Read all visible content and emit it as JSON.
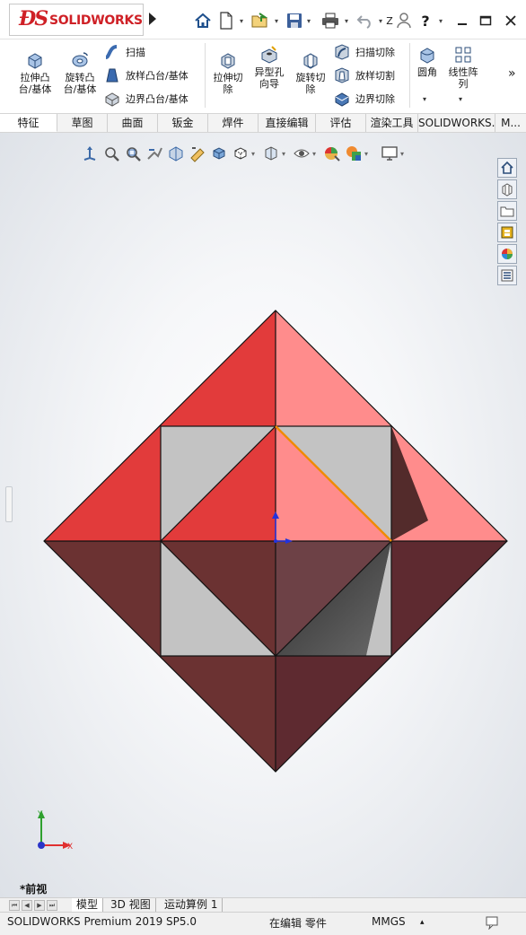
{
  "title_bar": {
    "brand": "SOLIDWORKS",
    "help_label": "?"
  },
  "ribbon": {
    "extrude_boss": "拉伸凸台/基体",
    "revolve_boss": "旋转凸台/基体",
    "sweep_boss": "扫描",
    "loft_boss": "放样凸台/基体",
    "boundary_boss": "边界凸台/基体",
    "extrude_cut": "拉伸切除",
    "hole_wizard": "异型孔向导",
    "revolve_cut": "旋转切除",
    "sweep_cut": "扫描切除",
    "loft_cut": "放样切割",
    "boundary_cut": "边界切除",
    "fillet": "圆角",
    "linear_pattern": "线性阵列",
    "overflow": "»"
  },
  "tabs": [
    "特征",
    "草图",
    "曲面",
    "钣金",
    "焊件",
    "直接编辑",
    "评估",
    "渲染工具",
    "SOLIDWORKS...",
    "M..."
  ],
  "viewport": {
    "view_name": "*前视",
    "triad_x": "X",
    "triad_y": "Y"
  },
  "bottom_tabs": [
    "模型",
    "3D 视图",
    "运动算例 1"
  ],
  "status": {
    "product": "SOLIDWORKS Premium 2019 SP5.0",
    "mode": "在编辑 零件",
    "units": "MMGS",
    "units_caret": "▴"
  },
  "colors": {
    "face_red": "#e23b3b",
    "face_pink": "#ff8c8c",
    "face_dark_left": "#6b3232",
    "face_dark_right": "#5e2a30",
    "square_gray": "#c3c3c3",
    "edge_selected": "#f08a00",
    "brand_red": "#cf2026"
  },
  "icons": [
    "home-icon",
    "new-file-icon",
    "open-file-icon",
    "save-icon",
    "print-icon",
    "undo-icon",
    "select-icon",
    "user-icon",
    "help-icon",
    "minimize-icon",
    "maximize-icon",
    "close-icon"
  ]
}
